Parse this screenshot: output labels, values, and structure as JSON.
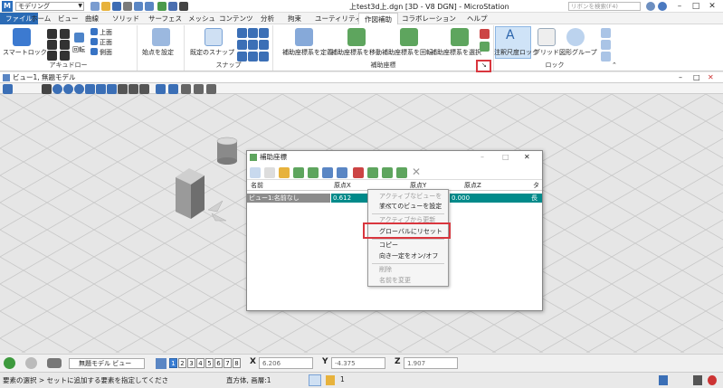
{
  "title_bar": {
    "app_logo": "M",
    "workspace": "モデリング",
    "window_title": "上test3d上.dgn [3D - V8 DGN] - MicroStation",
    "ribbon_search_placeholder": "リボンを検索(F4)"
  },
  "menus": [
    "ファイル",
    "ホーム",
    "ビュー",
    "曲線",
    "ソリッド",
    "サーフェス",
    "メッシュ",
    "コンテンツ",
    "分析",
    "拘束",
    "ユーティリティ",
    "作図補助",
    "コラボレーション",
    "ヘルプ"
  ],
  "active_menu": "作図補助",
  "ribbon": {
    "accudraw": {
      "label": "アキュドロー",
      "smart_lock": "スマートロック",
      "rotate": "回転",
      "top": "上面",
      "front": "正面",
      "side": "側面",
      "set_origin": "始点を設定"
    },
    "snap": {
      "label": "スナップ",
      "default_snap": "既定のスナップ"
    },
    "acs": {
      "label": "補助座標",
      "define": "補助座標系を定義",
      "move": "補助座標系を移動",
      "rotate": "補助座標系を回転",
      "select": "補助座標系を選択"
    },
    "lock": {
      "label": "ロック",
      "annotation_scale": "注釈尺度ロック",
      "grid": "グリッド",
      "graphic_group": "図形グループ"
    }
  },
  "view": {
    "title": "ビュー1, 無題モデル"
  },
  "dialog": {
    "title": "補助座標",
    "columns": [
      "名前",
      "原点X",
      "原点Y",
      "原点Z",
      "タ"
    ],
    "row": {
      "name": "ビュー1:名前なし",
      "x": "0.612",
      "y": "",
      "z": "0.000",
      "extra": "長"
    }
  },
  "context_menu": {
    "items": [
      {
        "label": "アクティブなビューを設定",
        "disabled": true
      },
      {
        "label": "すべてのビューを設定",
        "disabled": false
      },
      {
        "label": "アクティブから更新",
        "disabled": true
      },
      {
        "label": "グローバルにリセット",
        "disabled": false
      },
      {
        "label": "コピー",
        "disabled": false
      },
      {
        "label": "向き一定をオン/オフ",
        "disabled": false
      },
      {
        "label": "削除",
        "disabled": true
      },
      {
        "label": "名前を変更",
        "disabled": true
      }
    ]
  },
  "bottom_bar": {
    "model_selector": "無題モデル ビュー",
    "view_numbers": [
      "1",
      "2",
      "3",
      "4",
      "5",
      "6",
      "7",
      "8"
    ],
    "selected_view": "1",
    "x_label": "X",
    "x_value": "6.206",
    "y_label": "Y",
    "y_value": "-4.375",
    "z_label": "Z",
    "z_value": "1.907"
  },
  "status_bar": {
    "prompt": "要素の選択 > セットに追加する要素を指定してくださ",
    "element_info": "直方体, 画層:1",
    "level": "1"
  },
  "colors": {
    "accent": "#2b6bb5",
    "highlight_red": "#d9363e",
    "row_selected": "#008a8a",
    "row_gray": "#8c8c8c"
  }
}
